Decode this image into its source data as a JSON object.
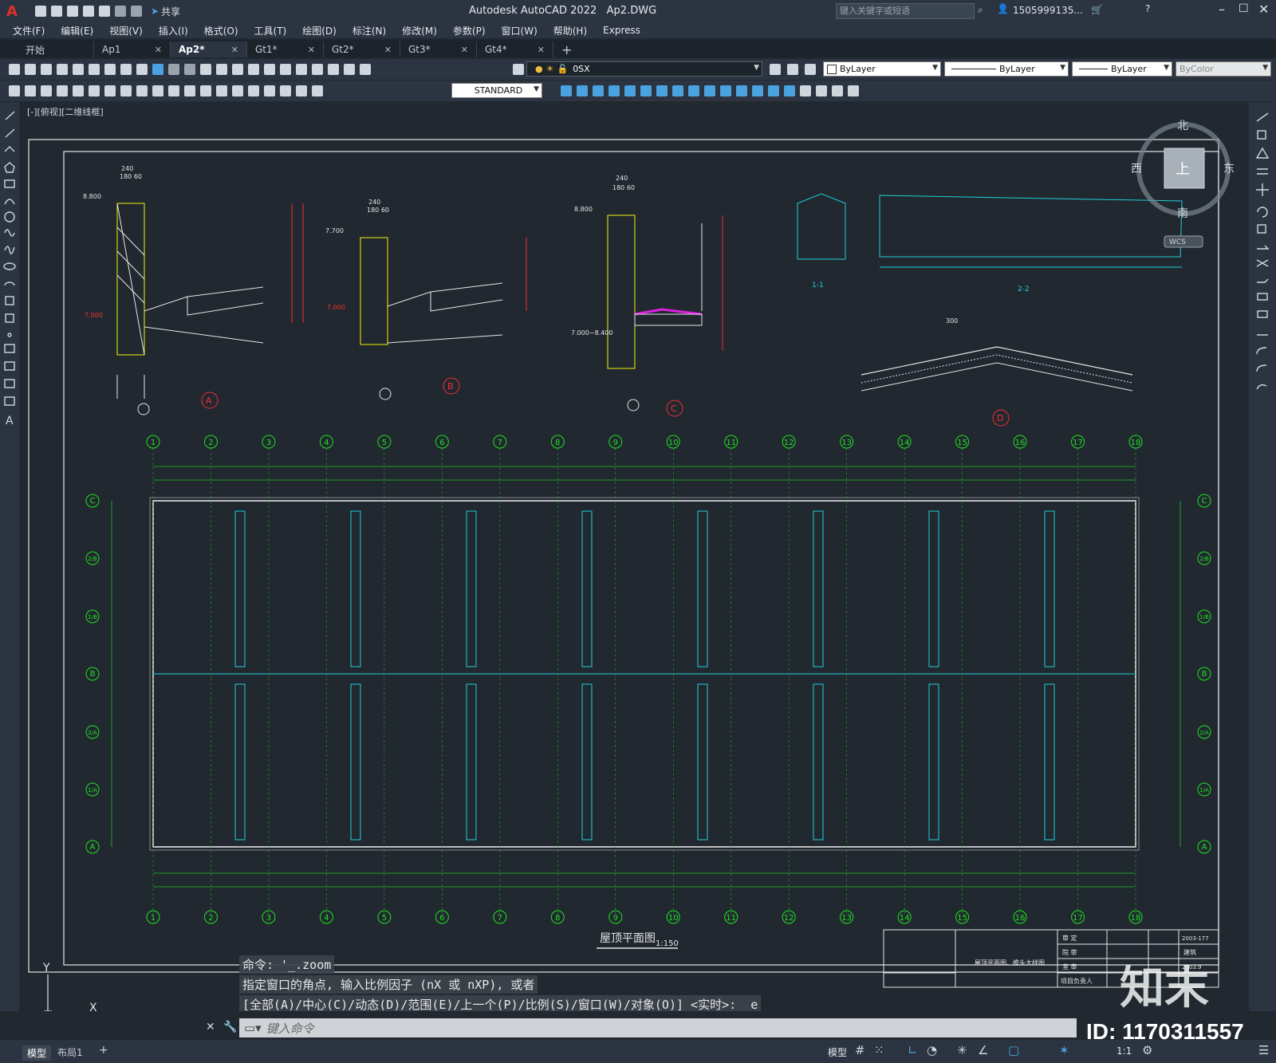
{
  "app": {
    "title": "Autodesk AutoCAD 2022",
    "filename": "Ap2.DWG",
    "search_placeholder": "键入关键字或短语",
    "user": "1505999135...",
    "share_label": "共享"
  },
  "menu": [
    "文件(F)",
    "编辑(E)",
    "视图(V)",
    "插入(I)",
    "格式(O)",
    "工具(T)",
    "绘图(D)",
    "标注(N)",
    "修改(M)",
    "参数(P)",
    "窗口(W)",
    "帮助(H)",
    "Express"
  ],
  "tabs": [
    {
      "label": "开始",
      "closable": false
    },
    {
      "label": "Ap1",
      "closable": true
    },
    {
      "label": "Ap2*",
      "closable": true,
      "active": true
    },
    {
      "label": "Gt1*",
      "closable": true
    },
    {
      "label": "Gt2*",
      "closable": true
    },
    {
      "label": "Gt3*",
      "closable": true
    },
    {
      "label": "Gt4*",
      "closable": true
    }
  ],
  "toolbar": {
    "layer_value": "0SX",
    "color_value": "ByLayer",
    "linetype_value": "ByLayer",
    "lineweight_value": "ByLayer",
    "plotstyle_value": "ByColor",
    "textstyle_value": "STANDARD"
  },
  "viewport": {
    "label": "[-][俯视][二维线框]",
    "viewcube": {
      "north": "北",
      "south": "南",
      "east": "东",
      "west": "西",
      "face": "上",
      "wcs": "WCS"
    }
  },
  "drawing": {
    "plan_title": "屋顶平面图",
    "plan_scale": "1:150",
    "grid_columns": [
      "1",
      "2",
      "3",
      "4",
      "5",
      "6",
      "7",
      "8",
      "9",
      "10",
      "11",
      "12",
      "13",
      "14",
      "15",
      "16",
      "17",
      "18"
    ],
    "grid_rows": [
      "C",
      "2/B",
      "1/B",
      "B",
      "2/A",
      "1/A",
      "A"
    ],
    "details": [
      {
        "id": "A",
        "elev_top": "8.800",
        "elev_low": "7.000",
        "dim_width": "240",
        "dims": "180 60"
      },
      {
        "id": "B",
        "elev_top": "7.700",
        "elev_low": "7.000",
        "dim_width": "240",
        "dims": "180 60"
      },
      {
        "id": "C",
        "elev_top": "8.800",
        "elev_low": "7.000~8.400",
        "dim_width": "240",
        "dims": "180 60"
      },
      {
        "id": "D",
        "dims": "300"
      }
    ],
    "section_labels": [
      "1-1",
      "2-2"
    ],
    "title_block": {
      "drawing_name": "屋顶平面图、檐头大样图",
      "drawing_no": "2003-177",
      "date": "2003.9",
      "discipline": "建筑",
      "rows": [
        "审 定",
        "院 审",
        "室 审",
        "项目负责人"
      ]
    }
  },
  "command": {
    "history": [
      "命令: '_.zoom",
      "指定窗口的角点, 输入比例因子 (nX 或 nXP), 或者",
      "[全部(A)/中心(C)/动态(D)/范围(E)/上一个(P)/比例(S)/窗口(W)/对象(O)] <实时>: _e"
    ],
    "placeholder": "键入命令"
  },
  "layout_tabs": [
    "模型",
    "布局1"
  ],
  "status": {
    "model_label": "模型",
    "scale": "1:1"
  },
  "watermark": {
    "brand": "知末",
    "id": "ID: 1170311557"
  }
}
